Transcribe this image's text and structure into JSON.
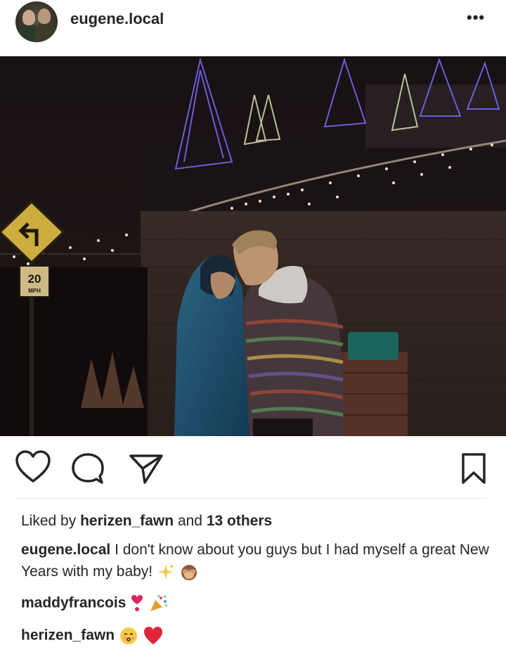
{
  "post": {
    "author": "eugene.local",
    "more_icon": "more-options-icon",
    "more_label": "•••",
    "likes": {
      "prefix": "Liked by",
      "user": "herizen_fawn",
      "middle": "and",
      "others": "13 others"
    },
    "caption": {
      "author": "eugene.local",
      "text": "I don't know about you guys but I had myself a great New Years with my baby!"
    },
    "comments": [
      {
        "user": "maddyfrancois",
        "emoji": [
          "heart-exclamation-emoji",
          "party-popper-emoji"
        ]
      },
      {
        "user": "herizen_fawn",
        "emoji": [
          "kissing-face-emoji",
          "red-heart-emoji"
        ]
      }
    ],
    "photo": {
      "sign_speed": "20",
      "sign_unit": "MPH"
    }
  },
  "icons": {
    "like": "heart-icon",
    "comment": "comment-bubble-icon",
    "share": "paper-plane-icon",
    "save": "bookmark-icon"
  },
  "colors": {
    "text": "#262626",
    "divider": "#e6e6e6",
    "heart": "#e0245e"
  }
}
